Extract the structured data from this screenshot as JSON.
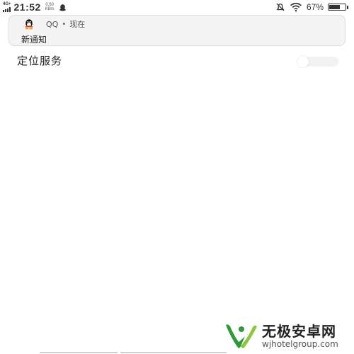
{
  "status_bar": {
    "network_type": "4G+",
    "time": "21:52",
    "speed_value": "0.60",
    "speed_unit": "KB/s",
    "battery_percent": "67%",
    "battery_level": 0.67,
    "icons": [
      "signal-icon",
      "qq-icon",
      "alarm-off-icon",
      "wifi-icon",
      "battery-icon"
    ]
  },
  "notification": {
    "app": "QQ",
    "time": "现在",
    "separator": "•",
    "body": "新通知",
    "icon": "qq-penguin-icon"
  },
  "settings": {
    "location_label": "定位服务",
    "location_enabled": false
  },
  "watermark": {
    "title": "无极安卓网",
    "url": "wjhotelgroup.com",
    "icon": "w-logo-icon",
    "colors": {
      "green": "#2e9a3e",
      "light_green": "#8cc63f"
    }
  }
}
